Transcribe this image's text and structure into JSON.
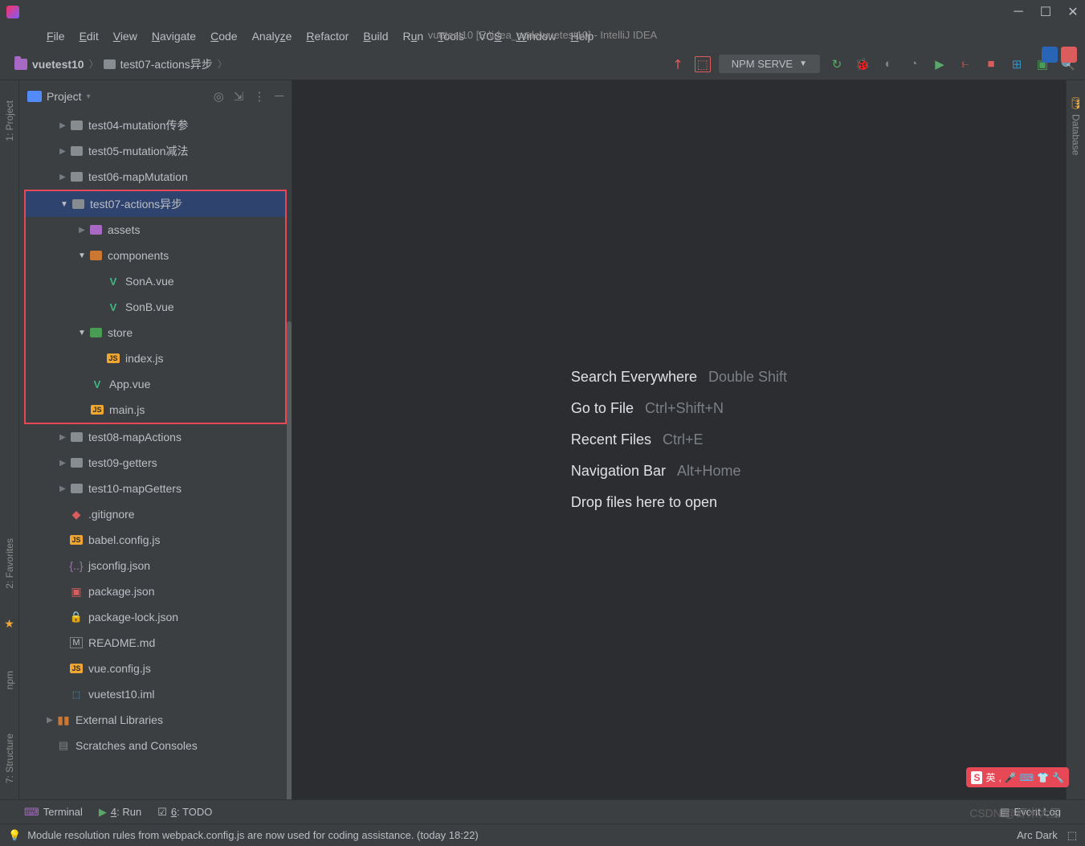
{
  "window": {
    "title": "vuetest10 [E:\\idea_code\\vuetest10] - IntelliJ IDEA"
  },
  "menu": [
    "File",
    "Edit",
    "View",
    "Navigate",
    "Code",
    "Analyze",
    "Refactor",
    "Build",
    "Run",
    "Tools",
    "VCS",
    "Window",
    "Help"
  ],
  "breadcrumb": {
    "root": "vuetest10",
    "path": "test07-actions异步"
  },
  "run_config": "NPM SERVE",
  "project_panel": {
    "title": "Project"
  },
  "left_strip": {
    "project": "1: Project",
    "favorites": "2: Favorites",
    "npm": "npm",
    "structure": "7: Structure"
  },
  "right_strip": {
    "database": "Database"
  },
  "tree": {
    "f1": "test04-mutation传参",
    "f2": "test05-mutation减法",
    "f3": "test06-mapMutation",
    "sel": "test07-actions异步",
    "sel_assets": "assets",
    "sel_components": "components",
    "sona": "SonA.vue",
    "sonb": "SonB.vue",
    "sel_store": "store",
    "indexjs": "index.js",
    "appvue": "App.vue",
    "mainjs": "main.js",
    "f4": "test08-mapActions",
    "f5": "test09-getters",
    "f6": "test10-mapGetters",
    "gitignore": ".gitignore",
    "babel": "babel.config.js",
    "jsconfig": "jsconfig.json",
    "pkg": "package.json",
    "pkglock": "package-lock.json",
    "readme": "README.md",
    "vueconfig": "vue.config.js",
    "iml": "vuetest10.iml",
    "extlib": "External Libraries",
    "scratches": "Scratches and Consoles"
  },
  "welcome": {
    "r1_label": "Search Everywhere",
    "r1_key": "Double Shift",
    "r2_label": "Go to File",
    "r2_key": "Ctrl+Shift+N",
    "r3_label": "Recent Files",
    "r3_key": "Ctrl+E",
    "r4_label": "Navigation Bar",
    "r4_key": "Alt+Home",
    "r5_label": "Drop files here to open"
  },
  "bottom_tabs": {
    "terminal": "Terminal",
    "run": "4: Run",
    "todo": "6: TODO",
    "event_log": "Event Log"
  },
  "status": {
    "msg": "Module resolution rules from webpack.config.js are now used for coding assistance. (today 18:22)",
    "theme": "Arc Dark"
  },
  "watermark": "CSDN @虾米大王",
  "overlay_ime": "英"
}
